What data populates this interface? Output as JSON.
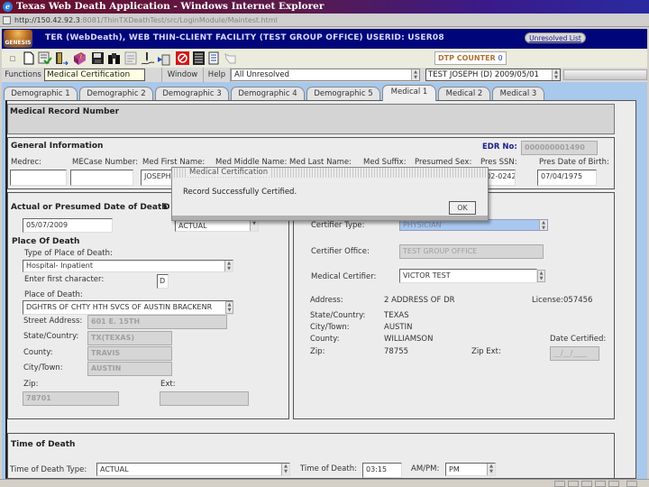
{
  "window": {
    "title": "Texas Web Death Application - Windows Internet Explorer",
    "url_host": "http://150.42.92.3",
    "url_path": ":8081/ThinTXDeathTest/src/LoginModule/Maintest.html"
  },
  "app_header": {
    "logo_text": "GENESIS",
    "title": "TER (WebDeath), WEB THIN-CLIENT FACILITY (TEST GROUP OFFICE) USERID: USER08",
    "unresolved_list_label": "Unresolved List"
  },
  "toolbar": {
    "icons": [
      "restore-icon",
      "new-document-icon",
      "certify-checklist-icon",
      "exit-door-icon",
      "help-book-icon",
      "save-floppy-icon",
      "find-binoculars-icon",
      "notes-icon",
      "pen-sign-icon",
      "transfer-icon",
      "void-icon",
      "report-icon",
      "list-icon",
      "hand-pointer-icon"
    ],
    "dtp_counter_label": "DTP COUNTER",
    "dtp_counter_value": "0"
  },
  "menu": {
    "items": [
      "Functions",
      "Medical Certification",
      "Window",
      "Help"
    ],
    "tooltip": "Medical Certification",
    "filter_value": "All Unresolved",
    "record_value": "TEST JOSEPH (D) 2009/05/01"
  },
  "tabs": [
    {
      "label": "Demographic 1",
      "active": false
    },
    {
      "label": "Demographic 2",
      "active": false
    },
    {
      "label": "Demographic 3",
      "active": false
    },
    {
      "label": "Demographic 4",
      "active": false
    },
    {
      "label": "Demographic 5",
      "active": false
    },
    {
      "label": "Medical 1",
      "active": true
    },
    {
      "label": "Medical 2",
      "active": false
    },
    {
      "label": "Medical 3",
      "active": false
    }
  ],
  "medical_record": {
    "title": "Medical Record Number"
  },
  "general_info": {
    "title": "General Information",
    "edr_label": "EDR No:",
    "edr_value": "000000001490",
    "labels": {
      "medrec": "Medrec:",
      "mecase": "MECase Number:",
      "first": "Med First Name:",
      "middle": "Med Middle Name:",
      "last": "Med Last Name:",
      "suffix": "Med Suffix:",
      "sex": "Presumed Sex:",
      "ssn": "Pres SSN:",
      "dob": "Pres Date of Birth:"
    },
    "values": {
      "medrec": "",
      "mecase": "",
      "first": "JOSEPH",
      "ssn": "301-02-0242",
      "dob": "07/04/1975"
    }
  },
  "date_of_death": {
    "title": "Actual or Presumed Date of Death",
    "title_right": "D",
    "date_value": "05/07/2009",
    "type_value": "ACTUAL"
  },
  "place_of_death": {
    "title": "Place Of Death",
    "type_label": "Type of Place of Death:",
    "type_value": "Hospital- Inpatient",
    "first_char_label": "Enter first character:",
    "first_char_value": "D",
    "place_label": "Place of Death:",
    "place_value": "DGHTRS OF CHTY HTH SVCS OF AUSTIN BRACKENR",
    "street_label": "Street Address:",
    "street_value": "601 E. 15TH",
    "state_label": "State/Country:",
    "state_value": "TX(TEXAS)",
    "county_label": "County:",
    "county_value": "TRAVIS",
    "city_label": "City/Town:",
    "city_value": "AUSTIN",
    "zip_label": "Zip:",
    "zip_value": "78701",
    "ext_label": "Ext:",
    "ext_value": ""
  },
  "certifier": {
    "type_label": "Certifier Type:",
    "type_value": "PHYSICIAN",
    "office_label": "Certifier Office:",
    "office_value": "TEST GROUP OFFICE",
    "medical_certifier_label": "Medical Certifier:",
    "medical_certifier_value": "VICTOR TEST",
    "address_label": "Address:",
    "address_value": "2 ADDRESS OF DR",
    "license_label": "License:",
    "license_value": "057456",
    "state_label": "State/Country:",
    "state_value": "TEXAS",
    "city_label": "City/Town:",
    "city_value": "AUSTIN",
    "county_label": "County:",
    "county_value": "WILLIAMSON",
    "zip_label": "Zip:",
    "zip_value": "78755",
    "zipext_label": "Zip Ext:",
    "date_certified_label": "Date Certified:",
    "date_certified_value": "__/__/____"
  },
  "time_of_death": {
    "title": "Time of Death",
    "type_label": "Time of Death Type:",
    "type_value": "ACTUAL",
    "time_label": "Time of Death:",
    "time_value": "03:15",
    "ampm_label": "AM/PM:",
    "ampm_value": "PM"
  },
  "dialog": {
    "title": "Medical Certification",
    "message": "Record Successfully Certified.",
    "ok_label": "OK"
  }
}
